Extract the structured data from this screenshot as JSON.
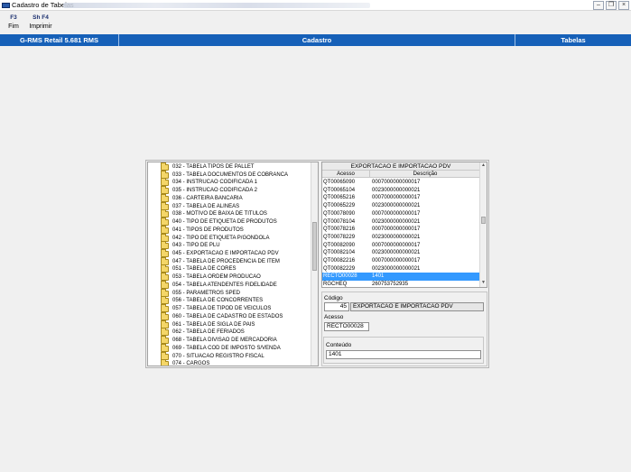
{
  "window": {
    "title": "Cadastro de Tabelas",
    "controls": [
      "minimize-icon",
      "restore-icon",
      "close-icon"
    ]
  },
  "toolbar": {
    "items": [
      {
        "key": "F3",
        "label": "Fim"
      },
      {
        "key": "Sh F4",
        "label": "Imprimir"
      }
    ]
  },
  "header": {
    "left": "G-RMS Retail 5.681 RMS",
    "center": "Cadastro",
    "right": "Tabelas"
  },
  "tree": {
    "items": [
      "032 - TABELA TIPOS DE PALLET",
      "033 - TABELA DOCUMENTOS DE COBRANCA",
      "034 - INSTRUCAO CODIFICADA 1",
      "035 - INSTRUCAO CODIFICADA 2",
      "036 - CARTEIRA BANCARIA",
      "037 - TABELA DE ALINEAS",
      "038 - MOTIVO DE BAIXA DE TITULOS",
      "040 - TIPO DE ETIQUETA DE PRODUTOS",
      "041 - TIPOS DE PRODUTOS",
      "042 - TIPO DE ETIQUETA P/GONDOLA",
      "043 - TIPO DE PLU",
      "045 - EXPORTACAO E IMPORTACAO PDV",
      "047 - TABELA DE PROCEDENCIA DE ITEM",
      "051 - TABELA DE CORES",
      "053 - TABELA ORDEM PRODUCAO",
      "054 - TABELA ATENDENTES FIDELIDADE",
      "055 - PARAMETROS SPED",
      "056 - TABELA DE CONCORRENTES",
      "057 - TABELA DE TIPOD DE VEICULOS",
      "060 - TABELA DE CADASTRO DE ESTADOS",
      "061 - TABELA DE SIGLA DE PAIS",
      "062 - TABELA DE FERIADOS",
      "068 - TABELA DIVISAO DE MERCADORIA",
      "069 - TABELA COD DE IMPOSTO S/VENDA",
      "070 - SITUACAO REGISTRO FISCAL",
      "074 - CARGOS"
    ]
  },
  "grid": {
    "title": "EXPORTACAO E IMPORTACAO PDV",
    "columns": [
      "Acesso",
      "Descrição"
    ],
    "rows": [
      [
        "QT00065090",
        "0007000000000017"
      ],
      [
        "QT00065104",
        "0023000000000021"
      ],
      [
        "QT00065216",
        "0007000000000017"
      ],
      [
        "QT00065229",
        "0023000000000021"
      ],
      [
        "QT00078090",
        "0007000000000017"
      ],
      [
        "QT00078104",
        "0023000000000021"
      ],
      [
        "QT00078216",
        "0007000000000017"
      ],
      [
        "QT00078229",
        "0023000000000021"
      ],
      [
        "QT00082090",
        "0007000000000017"
      ],
      [
        "QT00082104",
        "0023000000000021"
      ],
      [
        "QT00082216",
        "0007000000000017"
      ],
      [
        "QT00082229",
        "0023000000000021"
      ],
      [
        "RECTO00028",
        "1401"
      ],
      [
        "RGCHEQ",
        "260753752935"
      ]
    ],
    "selected_row": 12
  },
  "form": {
    "codigo_label": "Código",
    "codigo_value": "45",
    "codigo_desc": "EXPORTACAO E IMPORTACAO PDV",
    "acesso_label": "Acesso",
    "acesso_value": "RECTO00028",
    "conteudo_label": "Conteúdo",
    "conteudo_value": "1401"
  },
  "colors": {
    "header_bg": "#1660b8",
    "selection": "#3399ff",
    "folder": "#f4d668"
  }
}
